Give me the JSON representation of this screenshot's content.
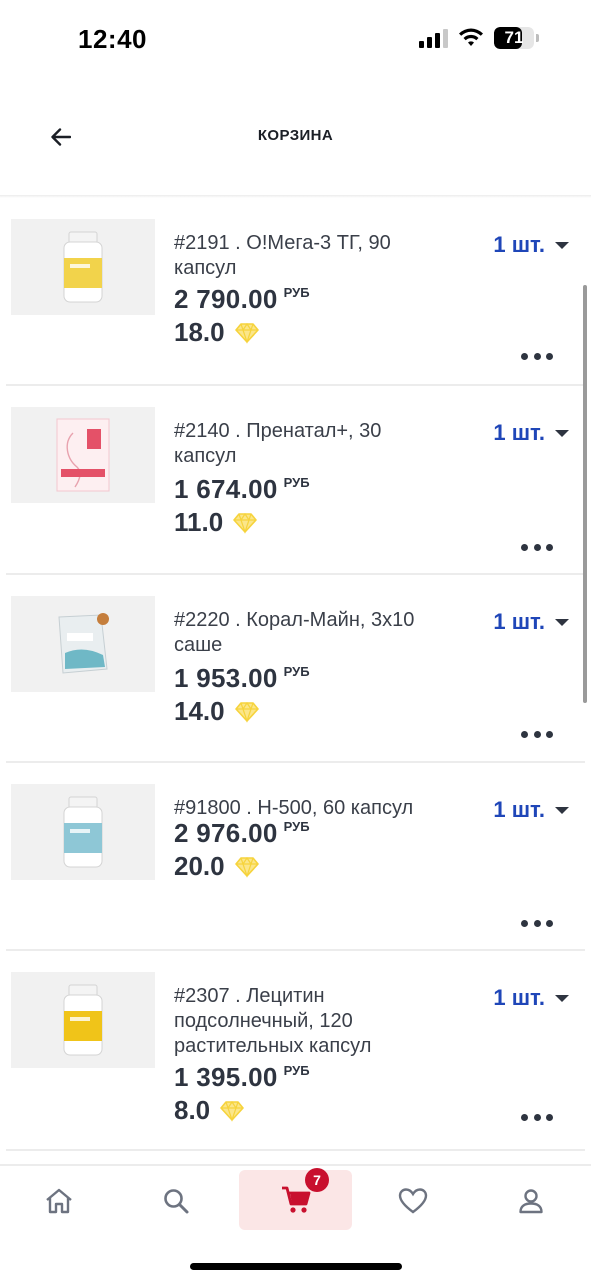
{
  "status_bar": {
    "time": "12:40",
    "battery": "71",
    "battery_level": 0.71
  },
  "header": {
    "title": "КОРЗИНА",
    "back_icon": "arrow-left-icon"
  },
  "cart": {
    "items": [
      {
        "title": "#2191 . О!Мега-3 ТГ, 90 капсул",
        "price": "2 790.00",
        "currency": "РУБ",
        "points": "18.0",
        "quantity": "1 шт.",
        "thumb_color": "#f2d34b",
        "thumb_type": "bottle-yellow"
      },
      {
        "title": "#2140 . Пренатал+, 30 капсул",
        "price": "1 674.00",
        "currency": "РУБ",
        "points": "11.0",
        "quantity": "1 шт.",
        "thumb_color": "#e45168",
        "thumb_type": "box-pink"
      },
      {
        "title": "#2220 . Корал-Майн, 3х10 саше",
        "price": "1 953.00",
        "currency": "РУБ",
        "points": "14.0",
        "quantity": "1 шт.",
        "thumb_color": "#6fb8c6",
        "thumb_type": "sachet"
      },
      {
        "title": "#91800 . Н-500, 60 капсул",
        "price": "2 976.00",
        "currency": "РУБ",
        "points": "20.0",
        "quantity": "1 шт.",
        "thumb_color": "#8ec7d6",
        "thumb_type": "bottle-blue"
      },
      {
        "title": "#2307 . Лецитин подсолнечный, 120 растительных капсул",
        "price": "1 395.00",
        "currency": "РУБ",
        "points": "8.0",
        "quantity": "1 шт.",
        "thumb_color": "#f0c419",
        "thumb_type": "bottle-yellow"
      }
    ]
  },
  "bottom_nav": {
    "items": [
      {
        "name": "home",
        "icon": "home-icon"
      },
      {
        "name": "search",
        "icon": "search-icon"
      },
      {
        "name": "cart",
        "icon": "cart-icon",
        "active": true,
        "badge": "7"
      },
      {
        "name": "favorites",
        "icon": "heart-icon"
      },
      {
        "name": "profile",
        "icon": "user-icon"
      }
    ]
  },
  "colors": {
    "accent": "#1f46b8",
    "cart_active_bg": "#fbe6e6",
    "badge": "#c8102e",
    "diamond": "#f6d33c"
  }
}
